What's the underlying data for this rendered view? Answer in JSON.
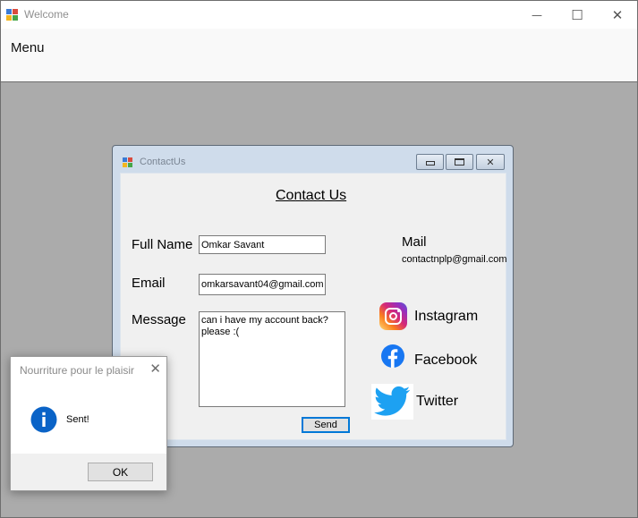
{
  "window": {
    "title": "Welcome",
    "minimize_glyph": "—",
    "maximize_glyph": "☐",
    "close_glyph": "✕"
  },
  "menu": {
    "label": "Menu"
  },
  "contact_window": {
    "title": "ContactUs",
    "heading": "Contact Us",
    "full_name_label": "Full Name",
    "full_name_value": "Omkar Savant",
    "email_label": "Email",
    "email_value": "omkarsavant04@gmail.com",
    "message_label": "Message",
    "message_value": "can i have my account back? please :(",
    "send_label": "Send",
    "mail_heading": "Mail",
    "mail_address": "contactnplp@gmail.com",
    "social": {
      "instagram": "Instagram",
      "facebook": "Facebook",
      "twitter": "Twitter"
    }
  },
  "dialog": {
    "title": "Nourriture pour le plaisir",
    "message": "Sent!",
    "ok_label": "OK",
    "close_glyph": "✕"
  },
  "colors": {
    "mdi_background": "#ababab",
    "accent_blue": "#0078d7",
    "info_icon": "#0a63c7",
    "facebook": "#1877f2",
    "twitter": "#1da1f2"
  }
}
